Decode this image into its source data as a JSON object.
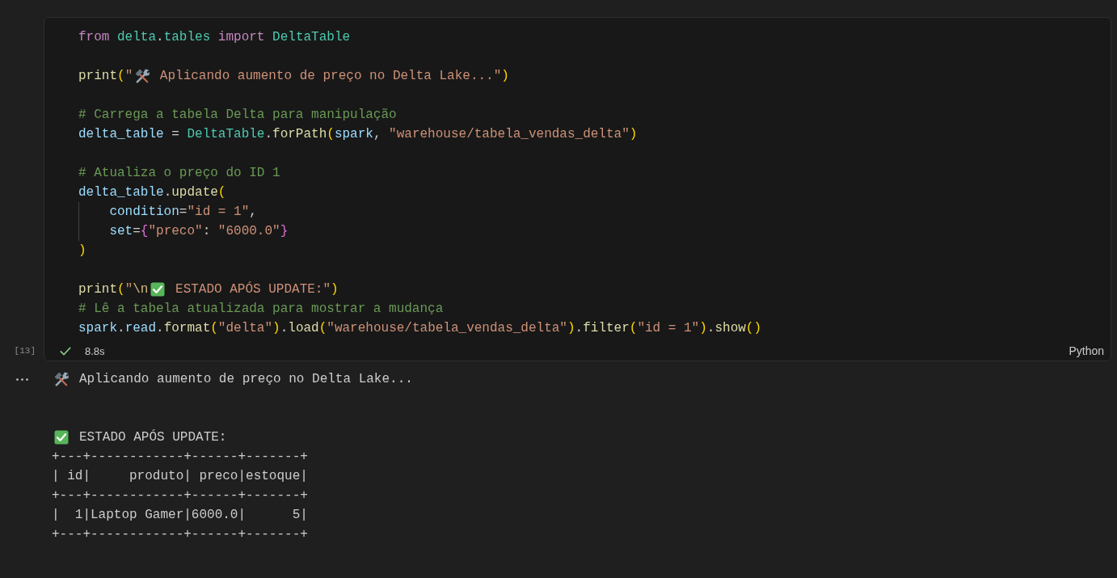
{
  "cell": {
    "execution_count": "[13]",
    "code_lines": [
      {
        "kind": "code",
        "tokens": [
          {
            "kind": "keyword",
            "text": "from "
          },
          {
            "kind": "type",
            "text": "delta"
          },
          {
            "kind": "plain",
            "text": "."
          },
          {
            "kind": "type",
            "text": "tables "
          },
          {
            "kind": "keyword",
            "text": "import "
          },
          {
            "kind": "type",
            "text": "DeltaTable"
          }
        ]
      },
      {
        "kind": "blank"
      },
      {
        "kind": "code",
        "tokens": [
          {
            "kind": "function",
            "text": "print"
          },
          {
            "kind": "bracket1",
            "text": "("
          },
          {
            "kind": "string",
            "text": "\""
          },
          {
            "kind": "tools"
          },
          {
            "kind": "string",
            "text": " Aplicando aumento de preço no Delta Lake...\""
          },
          {
            "kind": "bracket1",
            "text": ")"
          }
        ]
      },
      {
        "kind": "blank"
      },
      {
        "kind": "code",
        "tokens": [
          {
            "kind": "comment",
            "text": "# Carrega a tabela Delta para manipulação"
          }
        ]
      },
      {
        "kind": "code",
        "tokens": [
          {
            "kind": "variable",
            "text": "delta_table"
          },
          {
            "kind": "plain",
            "text": " = "
          },
          {
            "kind": "type",
            "text": "DeltaTable"
          },
          {
            "kind": "plain",
            "text": "."
          },
          {
            "kind": "function",
            "text": "forPath"
          },
          {
            "kind": "bracket1",
            "text": "("
          },
          {
            "kind": "variable",
            "text": "spark"
          },
          {
            "kind": "plain",
            "text": ", "
          },
          {
            "kind": "string",
            "text": "\"warehouse/tabela_vendas_delta\""
          },
          {
            "kind": "bracket1",
            "text": ")"
          }
        ]
      },
      {
        "kind": "blank"
      },
      {
        "kind": "code",
        "tokens": [
          {
            "kind": "comment",
            "text": "# Atualiza o preço do ID 1"
          }
        ]
      },
      {
        "kind": "code",
        "tokens": [
          {
            "kind": "variable",
            "text": "delta_table"
          },
          {
            "kind": "plain",
            "text": "."
          },
          {
            "kind": "function",
            "text": "update"
          },
          {
            "kind": "bracket1",
            "text": "("
          }
        ]
      },
      {
        "kind": "code",
        "tokens": [
          {
            "kind": "variable",
            "text": "    condition"
          },
          {
            "kind": "plain",
            "text": "="
          },
          {
            "kind": "string",
            "text": "\"id = 1\""
          },
          {
            "kind": "plain",
            "text": ","
          }
        ]
      },
      {
        "kind": "code",
        "tokens": [
          {
            "kind": "variable",
            "text": "    set"
          },
          {
            "kind": "plain",
            "text": "="
          },
          {
            "kind": "bracket2",
            "text": "{"
          },
          {
            "kind": "string",
            "text": "\"preco\""
          },
          {
            "kind": "plain",
            "text": ": "
          },
          {
            "kind": "string",
            "text": "\"6000.0\""
          },
          {
            "kind": "bracket2",
            "text": "}"
          }
        ]
      },
      {
        "kind": "code",
        "tokens": [
          {
            "kind": "bracket1",
            "text": ")"
          }
        ]
      },
      {
        "kind": "blank"
      },
      {
        "kind": "code",
        "tokens": [
          {
            "kind": "function",
            "text": "print"
          },
          {
            "kind": "bracket1",
            "text": "("
          },
          {
            "kind": "string",
            "text": "\""
          },
          {
            "kind": "escape",
            "text": "\\n"
          },
          {
            "kind": "check"
          },
          {
            "kind": "string",
            "text": " ESTADO APÓS UPDATE:\""
          },
          {
            "kind": "bracket1",
            "text": ")"
          }
        ]
      },
      {
        "kind": "code",
        "tokens": [
          {
            "kind": "comment",
            "text": "# Lê a tabela atualizada para mostrar a mudança"
          }
        ]
      },
      {
        "kind": "code",
        "tokens": [
          {
            "kind": "variable",
            "text": "spark"
          },
          {
            "kind": "plain",
            "text": "."
          },
          {
            "kind": "variable",
            "text": "read"
          },
          {
            "kind": "plain",
            "text": "."
          },
          {
            "kind": "function",
            "text": "format"
          },
          {
            "kind": "bracket1",
            "text": "("
          },
          {
            "kind": "string",
            "text": "\"delta\""
          },
          {
            "kind": "bracket1",
            "text": ")"
          },
          {
            "kind": "plain",
            "text": "."
          },
          {
            "kind": "function",
            "text": "load"
          },
          {
            "kind": "bracket1",
            "text": "("
          },
          {
            "kind": "string",
            "text": "\"warehouse/tabela_vendas_delta\""
          },
          {
            "kind": "bracket1",
            "text": ")"
          },
          {
            "kind": "plain",
            "text": "."
          },
          {
            "kind": "function",
            "text": "filter"
          },
          {
            "kind": "bracket1",
            "text": "("
          },
          {
            "kind": "string",
            "text": "\"id = 1\""
          },
          {
            "kind": "bracket1",
            "text": ")"
          },
          {
            "kind": "plain",
            "text": "."
          },
          {
            "kind": "function",
            "text": "show"
          },
          {
            "kind": "bracket1",
            "text": "()"
          }
        ]
      }
    ],
    "succeeded": true,
    "duration": "8.8s",
    "language": "Python"
  },
  "output": {
    "lines": [
      {
        "kind": "tools_message",
        "text": "Aplicando aumento de preço no Delta Lake..."
      },
      {
        "kind": "blank"
      },
      {
        "kind": "blank"
      },
      {
        "kind": "check_message",
        "text": "ESTADO APÓS UPDATE:"
      },
      {
        "kind": "text",
        "text": "+---+------------+------+-------+"
      },
      {
        "kind": "text",
        "text": "| id|     produto| preco|estoque|"
      },
      {
        "kind": "text",
        "text": "+---+------------+------+-------+"
      },
      {
        "kind": "text",
        "text": "|  1|Laptop Gamer|6000.0|      5|"
      },
      {
        "kind": "text",
        "text": "+---+------------+------+-------+"
      }
    ]
  }
}
